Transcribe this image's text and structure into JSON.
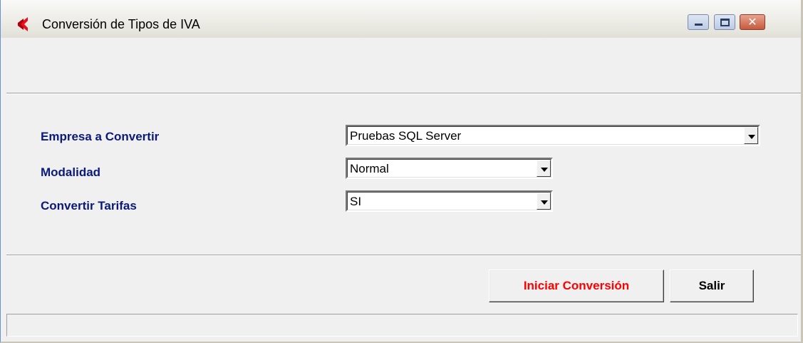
{
  "window": {
    "title": "Conversión de Tipos de IVA",
    "icon": "red-c-app-icon",
    "controls": {
      "minimize_icon": "minimize-icon",
      "maximize_icon": "maximize-icon",
      "close_icon": "close-icon",
      "close_glyph": "✕"
    }
  },
  "form": {
    "empresa_label": "Empresa a Convertir",
    "empresa_value": "Pruebas SQL Server",
    "modalidad_label": "Modalidad",
    "modalidad_value": "Normal",
    "tarifas_label": "Convertir Tarifas",
    "tarifas_value": "SI"
  },
  "buttons": {
    "start_label": "Iniciar Conversión",
    "exit_label": "Salir"
  },
  "status": {
    "text": ""
  },
  "colors": {
    "label": "#0a1a7a",
    "start_button_text": "#ff0000",
    "app_icon": "#e8101c"
  }
}
